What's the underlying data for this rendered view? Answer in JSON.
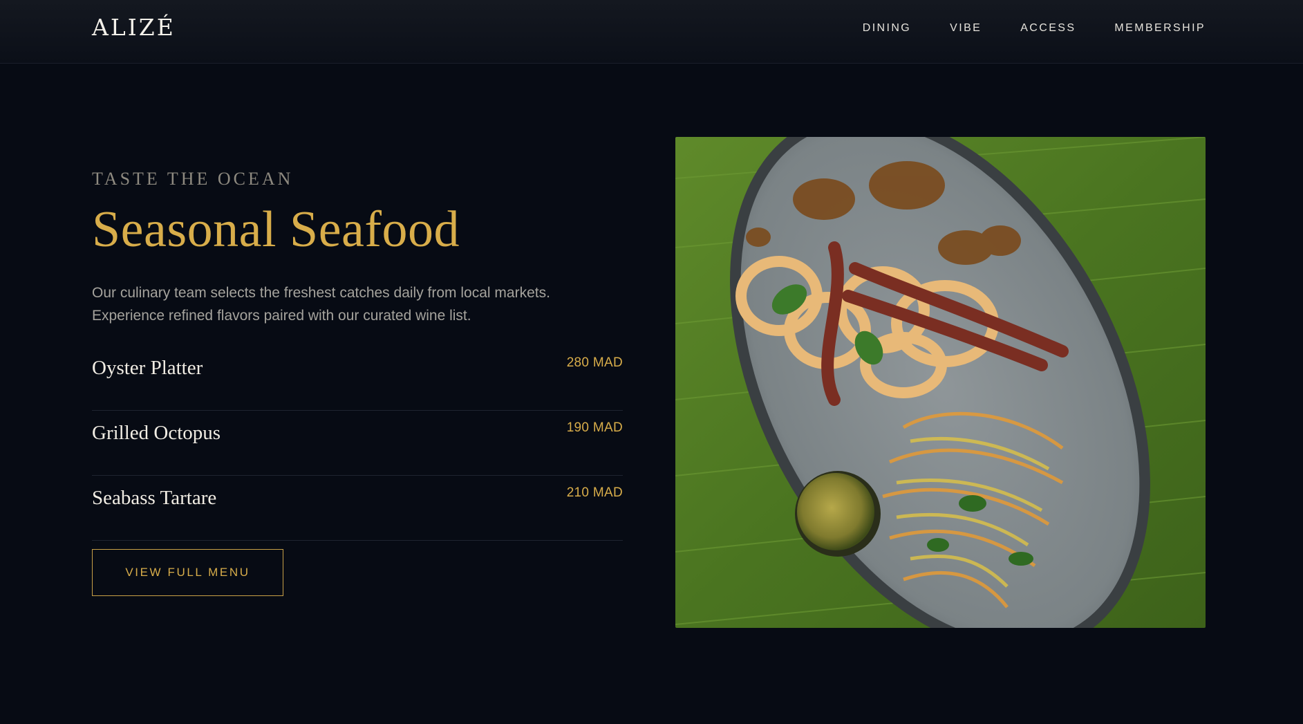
{
  "brand": {
    "logo": "ALIZÉ"
  },
  "nav": {
    "items": [
      "DINING",
      "VIBE",
      "ACCESS",
      "MEMBERSHIP"
    ]
  },
  "section": {
    "eyebrow": "TASTE THE OCEAN",
    "title": "Seasonal Seafood",
    "description_line1": "Our culinary team selects the freshest catches daily from local markets.",
    "description_line2": "Experience refined flavors paired with our curated wine list."
  },
  "menu": {
    "items": [
      {
        "name": "Oyster Platter",
        "price": "280 MAD"
      },
      {
        "name": "Grilled Octopus",
        "price": "190 MAD"
      },
      {
        "name": "Seabass Tartare",
        "price": "210 MAD"
      }
    ],
    "cta_label": "VIEW FULL MENU"
  },
  "colors": {
    "background": "#070b14",
    "accent_gold": "#d8ad4a",
    "text_light": "#f1ede4",
    "text_muted": "#a5a39d"
  },
  "image": {
    "subject": "seafood-plate-photo"
  }
}
